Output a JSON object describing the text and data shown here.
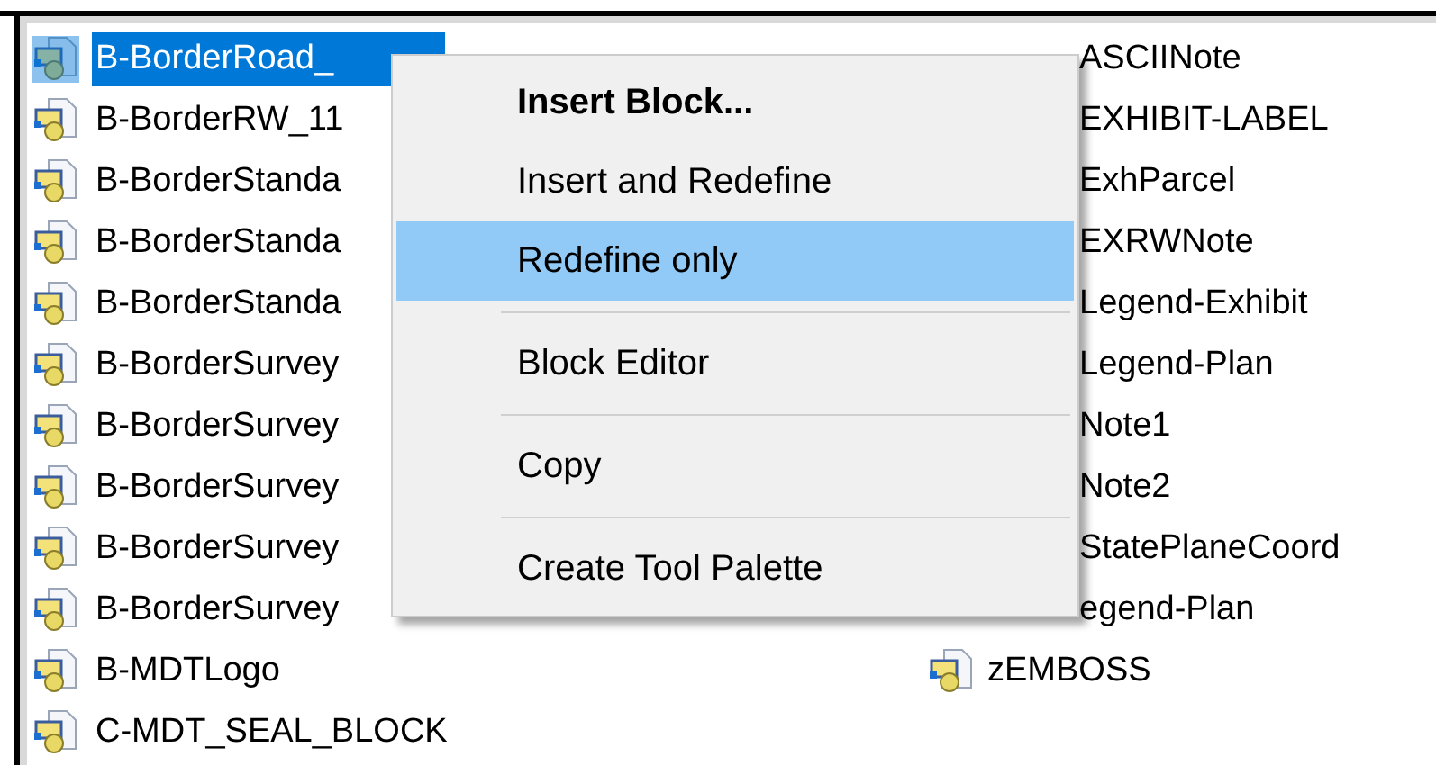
{
  "left_column": [
    {
      "label": "B-BorderRoad_",
      "selected": true
    },
    {
      "label": "B-BorderRW_11",
      "selected": false
    },
    {
      "label": "B-BorderStanda",
      "selected": false
    },
    {
      "label": "B-BorderStanda",
      "selected": false
    },
    {
      "label": "B-BorderStanda",
      "selected": false
    },
    {
      "label": "B-BorderSurvey",
      "selected": false
    },
    {
      "label": "B-BorderSurvey",
      "selected": false
    },
    {
      "label": "B-BorderSurvey",
      "selected": false
    },
    {
      "label": "B-BorderSurvey",
      "selected": false
    },
    {
      "label": "B-BorderSurvey",
      "selected": false
    },
    {
      "label": "B-MDTLogo",
      "selected": false
    },
    {
      "label": "C-MDT_SEAL_BLOCK",
      "selected": false
    }
  ],
  "right_column": [
    {
      "label": "ASCIINote",
      "kind": "partial"
    },
    {
      "label": "EXHIBIT-LABEL",
      "kind": "partial"
    },
    {
      "label": "ExhParcel",
      "kind": "partial"
    },
    {
      "label": "EXRWNote",
      "kind": "partial"
    },
    {
      "label": "Legend-Exhibit",
      "kind": "partial"
    },
    {
      "label": "Legend-Plan",
      "kind": "partial"
    },
    {
      "label": "Note1",
      "kind": "partial"
    },
    {
      "label": "Note2",
      "kind": "partial"
    },
    {
      "label": "StatePlaneCoord",
      "kind": "partial"
    },
    {
      "label": "egend-Plan",
      "kind": "partial"
    },
    {
      "label": "zEMBOSS",
      "kind": "full"
    }
  ],
  "context_menu": [
    {
      "kind": "item",
      "label": "Insert Block...",
      "bold": true,
      "selected": false
    },
    {
      "kind": "item",
      "label": "Insert and Redefine",
      "bold": false,
      "selected": false
    },
    {
      "kind": "item",
      "label": "Redefine only",
      "bold": false,
      "selected": true
    },
    {
      "kind": "separator"
    },
    {
      "kind": "item",
      "label": "Block Editor",
      "bold": false,
      "selected": false
    },
    {
      "kind": "separator"
    },
    {
      "kind": "item",
      "label": "Copy",
      "bold": false,
      "selected": false
    },
    {
      "kind": "separator"
    },
    {
      "kind": "item",
      "label": "Create Tool Palette",
      "bold": false,
      "selected": false
    }
  ]
}
